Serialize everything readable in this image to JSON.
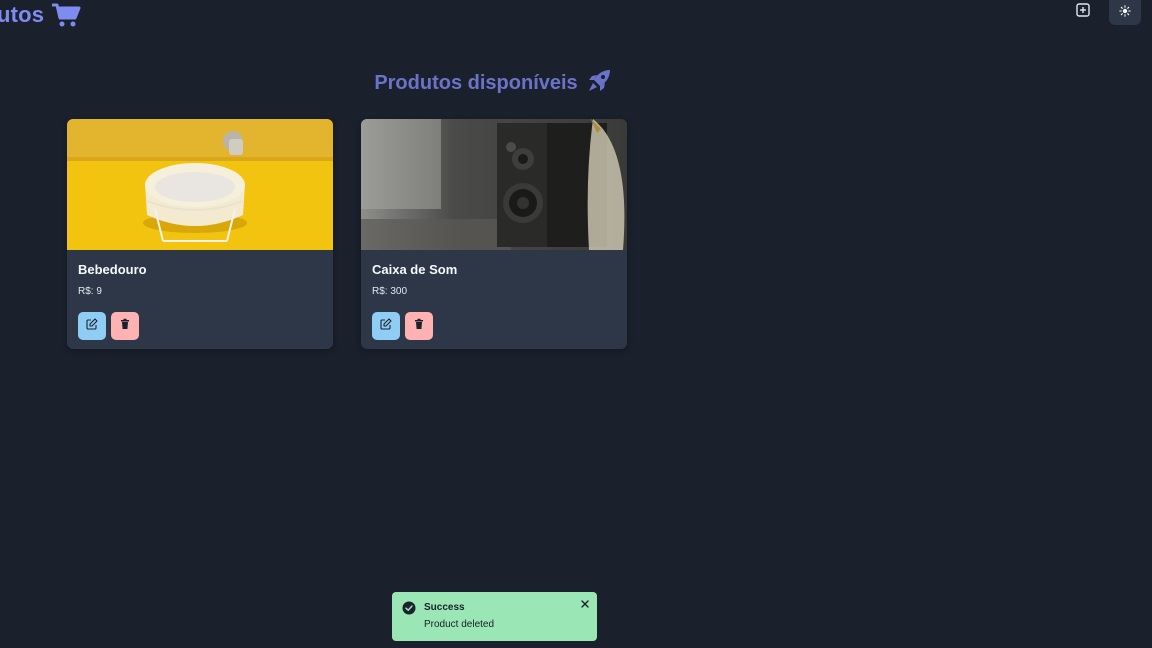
{
  "app": {
    "brand_text": "utos",
    "brand_icon": "cart-icon",
    "accent_color": "#7f8cef"
  },
  "top_actions": [
    {
      "name": "add-product-button",
      "icon": "plus-square-icon"
    },
    {
      "name": "theme-toggle-button",
      "icon": "sun-icon"
    }
  ],
  "page": {
    "title": "Produtos disponíveis",
    "title_icon": "rocket-icon"
  },
  "products": [
    {
      "name": "Bebedouro",
      "price": "R$: 9",
      "image": "bowl-image"
    },
    {
      "name": "Caixa de Som",
      "price": "R$: 300",
      "image": "speaker-image"
    }
  ],
  "toast": {
    "title": "Success",
    "description": "Product deleted",
    "status_color": "#9ae6b4"
  }
}
